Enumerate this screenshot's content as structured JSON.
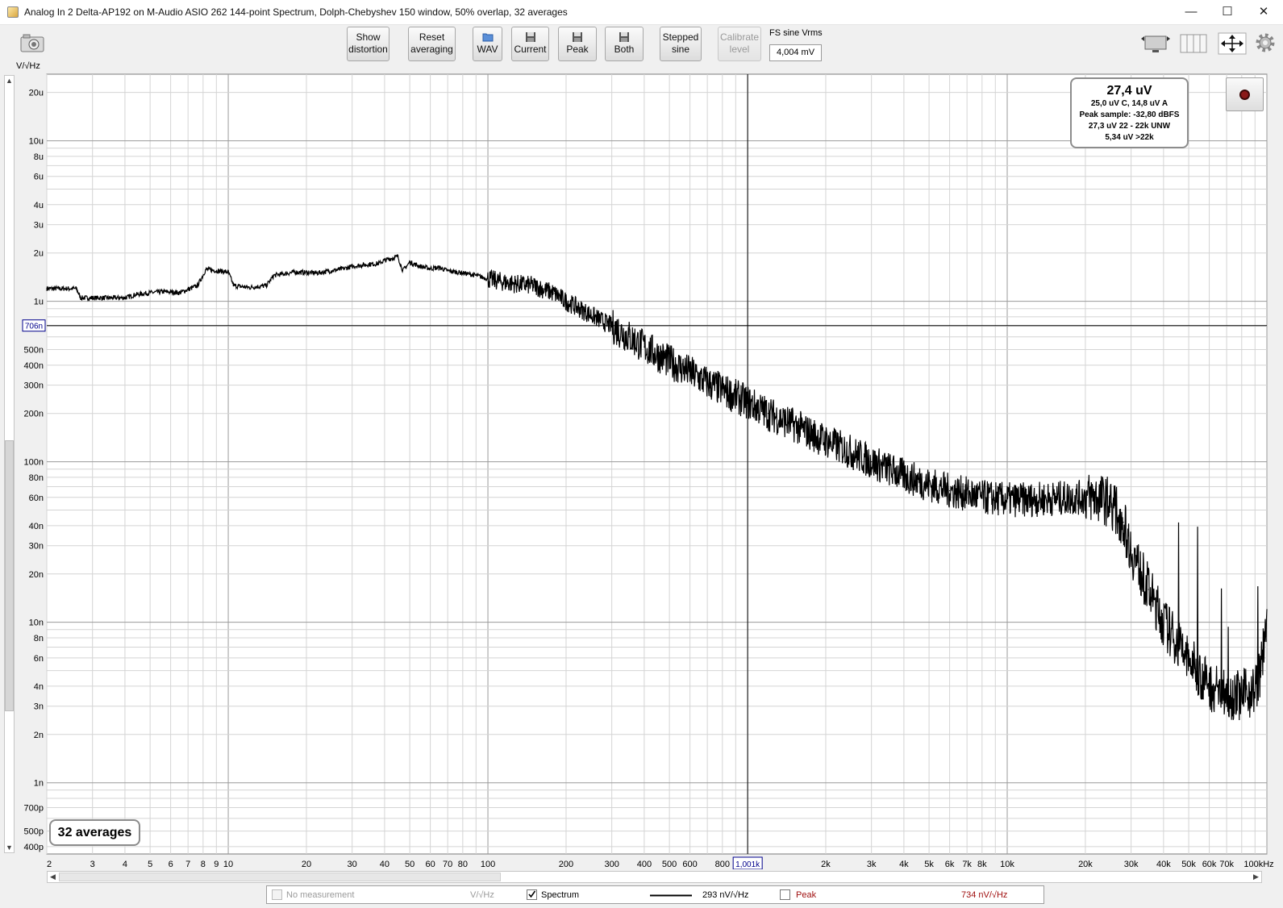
{
  "window": {
    "title": "Analog In 2 Delta-AP192 on M-Audio ASIO 262 144-point Spectrum, Dolph-Chebyshev 150 window, 50% overlap, 32 averages",
    "minimize": "—",
    "maximize": "☐",
    "close": "✕"
  },
  "toolbar": {
    "show_distortion": [
      "Show",
      "distortion"
    ],
    "reset_averaging": [
      "Reset",
      "averaging"
    ],
    "wav": "WAV",
    "current": "Current",
    "peak": "Peak",
    "both": "Both",
    "stepped_sine": [
      "Stepped",
      "sine"
    ],
    "calibrate_level": [
      "Calibrate",
      "level"
    ],
    "fs_label": "FS sine Vrms",
    "fs_value": "4,004 mV"
  },
  "unit_label": "V/√Hz",
  "stats": {
    "main": "27,4 uV",
    "lines": [
      "25,0 uV C, 14,8 uV A",
      "Peak sample: -32,80 dBFS",
      "27,3 uV 22 - 22k UNW",
      "5,34 uV >22k"
    ]
  },
  "averages_label": "32 averages",
  "cursor": {
    "y_label": "706n",
    "x_label": "1,001k",
    "x_hz": 1001,
    "y_value": 7.06e-07
  },
  "legend": {
    "no_measurement": "No measurement",
    "no_measurement_unit": "V/√Hz",
    "spectrum": "Spectrum",
    "spectrum_value": "293 nV/√Hz",
    "spectrum_checked": true,
    "peak": "Peak",
    "peak_value": "734 nV/√Hz",
    "peak_checked": false
  },
  "colors": {
    "trace": "#000000",
    "peak_text": "#a01010",
    "cursor_label": "#00008b",
    "grid_major": "#9a9a9a",
    "grid_minor": "#d4d4d4"
  },
  "chart_data": {
    "type": "line",
    "xscale": "log",
    "yscale": "log",
    "xlim": [
      2,
      100000
    ],
    "ylim": [
      3.6e-10,
      2.6e-05
    ],
    "x_unit": "kHz",
    "x_ticks": [
      {
        "v": 2,
        "t": "2"
      },
      {
        "v": 3,
        "t": "3"
      },
      {
        "v": 4,
        "t": "4"
      },
      {
        "v": 5,
        "t": "5"
      },
      {
        "v": 6,
        "t": "6"
      },
      {
        "v": 7,
        "t": "7"
      },
      {
        "v": 8,
        "t": "8"
      },
      {
        "v": 9,
        "t": "9"
      },
      {
        "v": 10,
        "t": "10"
      },
      {
        "v": 20,
        "t": "20"
      },
      {
        "v": 30,
        "t": "30"
      },
      {
        "v": 40,
        "t": "40"
      },
      {
        "v": 50,
        "t": "50"
      },
      {
        "v": 60,
        "t": "60"
      },
      {
        "v": 70,
        "t": "70"
      },
      {
        "v": 80,
        "t": "80"
      },
      {
        "v": 100,
        "t": "100"
      },
      {
        "v": 200,
        "t": "200"
      },
      {
        "v": 300,
        "t": "300"
      },
      {
        "v": 400,
        "t": "400"
      },
      {
        "v": 500,
        "t": "500"
      },
      {
        "v": 600,
        "t": "600"
      },
      {
        "v": 800,
        "t": "800"
      },
      {
        "v": 2000,
        "t": "2k"
      },
      {
        "v": 3000,
        "t": "3k"
      },
      {
        "v": 4000,
        "t": "4k"
      },
      {
        "v": 5000,
        "t": "5k"
      },
      {
        "v": 6000,
        "t": "6k"
      },
      {
        "v": 7000,
        "t": "7k"
      },
      {
        "v": 8000,
        "t": "8k"
      },
      {
        "v": 10000,
        "t": "10k"
      },
      {
        "v": 20000,
        "t": "20k"
      },
      {
        "v": 30000,
        "t": "30k"
      },
      {
        "v": 40000,
        "t": "40k"
      },
      {
        "v": 50000,
        "t": "50k"
      },
      {
        "v": 60000,
        "t": "60k"
      },
      {
        "v": 70000,
        "t": "70k"
      },
      {
        "v": 100000,
        "t": "100kHz"
      }
    ],
    "y_ticks": [
      {
        "v": 2e-05,
        "t": "20u"
      },
      {
        "v": 1e-05,
        "t": "10u"
      },
      {
        "v": 8e-06,
        "t": "8u"
      },
      {
        "v": 6e-06,
        "t": "6u"
      },
      {
        "v": 4e-06,
        "t": "4u"
      },
      {
        "v": 3e-06,
        "t": "3u"
      },
      {
        "v": 2e-06,
        "t": "2u"
      },
      {
        "v": 1e-06,
        "t": "1u"
      },
      {
        "v": 5e-07,
        "t": "500n"
      },
      {
        "v": 4e-07,
        "t": "400n"
      },
      {
        "v": 3e-07,
        "t": "300n"
      },
      {
        "v": 2e-07,
        "t": "200n"
      },
      {
        "v": 1e-07,
        "t": "100n"
      },
      {
        "v": 8e-08,
        "t": "80n"
      },
      {
        "v": 6e-08,
        "t": "60n"
      },
      {
        "v": 4e-08,
        "t": "40n"
      },
      {
        "v": 3e-08,
        "t": "30n"
      },
      {
        "v": 2e-08,
        "t": "20n"
      },
      {
        "v": 1e-08,
        "t": "10n"
      },
      {
        "v": 8e-09,
        "t": "8n"
      },
      {
        "v": 6e-09,
        "t": "6n"
      },
      {
        "v": 4e-09,
        "t": "4n"
      },
      {
        "v": 3e-09,
        "t": "3n"
      },
      {
        "v": 2e-09,
        "t": "2n"
      },
      {
        "v": 1e-09,
        "t": "1n"
      },
      {
        "v": 7e-10,
        "t": "700p"
      },
      {
        "v": 5e-10,
        "t": "500p"
      },
      {
        "v": 4e-10,
        "t": "400p"
      }
    ],
    "series": [
      {
        "x": [
          2,
          2.6,
          2.7,
          4,
          4.4,
          5,
          5.7,
          6.5,
          7.6,
          7.9,
          8.2,
          10,
          10.5,
          12,
          14,
          15,
          18,
          22,
          25,
          28,
          30,
          33,
          35,
          38,
          40,
          45,
          47,
          50,
          55,
          60,
          65,
          70,
          80,
          90,
          100,
          120,
          150,
          180,
          200,
          250,
          300,
          350,
          400,
          500,
          600,
          700,
          800,
          1000,
          1200,
          1500,
          2000,
          2500,
          3000,
          4000,
          5000,
          6000,
          7000,
          8000,
          10000,
          12000,
          15000,
          20000,
          22000,
          25000,
          28000,
          30000,
          35000,
          40000,
          50000,
          60000,
          70000,
          80000,
          90000,
          95000,
          100000
        ],
        "y": [
          1.2e-06,
          1.2e-06,
          1.05e-06,
          1.05e-06,
          1.1e-06,
          1.13e-06,
          1.15e-06,
          1.13e-06,
          1.25e-06,
          1.4e-06,
          1.58e-06,
          1.52e-06,
          1.25e-06,
          1.22e-06,
          1.25e-06,
          1.45e-06,
          1.52e-06,
          1.5e-06,
          1.55e-06,
          1.6e-06,
          1.65e-06,
          1.68e-06,
          1.7e-06,
          1.72e-06,
          1.8e-06,
          1.9e-06,
          1.55e-06,
          1.75e-06,
          1.65e-06,
          1.6e-06,
          1.62e-06,
          1.55e-06,
          1.5e-06,
          1.45e-06,
          1.38e-06,
          1.3e-06,
          1.25e-06,
          1.12e-06,
          1e-06,
          8.2e-07,
          7e-07,
          6e-07,
          5.2e-07,
          4.2e-07,
          3.6e-07,
          3.1e-07,
          2.8e-07,
          2.35e-07,
          2e-07,
          1.7e-07,
          1.35e-07,
          1.15e-07,
          1e-07,
          8.2e-08,
          7.2e-08,
          6.6e-08,
          6.3e-08,
          6e-08,
          5.8e-08,
          5.8e-08,
          5.9e-08,
          6e-08,
          6e-08,
          5.6e-08,
          4.2e-08,
          2.8e-08,
          1.6e-08,
          1e-08,
          5.8e-09,
          4e-09,
          3.6e-09,
          3.5e-09,
          3.8e-09,
          5e-09,
          1.2e-08
        ]
      }
    ]
  }
}
